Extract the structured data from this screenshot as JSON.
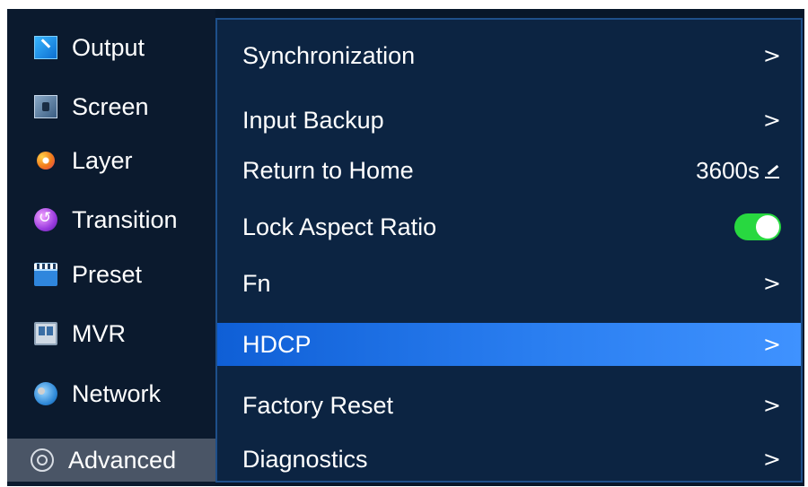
{
  "sidebar": {
    "items": [
      {
        "label": "Output",
        "icon": "output-icon"
      },
      {
        "label": "Screen",
        "icon": "screen-icon"
      },
      {
        "label": "Layer",
        "icon": "layer-icon"
      },
      {
        "label": "Transition",
        "icon": "transition-icon"
      },
      {
        "label": "Preset",
        "icon": "preset-icon"
      },
      {
        "label": "MVR",
        "icon": "mvr-icon"
      },
      {
        "label": "Network",
        "icon": "network-icon"
      },
      {
        "label": "Advanced",
        "icon": "advanced-icon",
        "active": true
      }
    ]
  },
  "menu": {
    "rows": [
      {
        "label": "Synchronization",
        "type": "submenu"
      },
      {
        "label": "Input Backup",
        "type": "submenu"
      },
      {
        "label": "Return to Home",
        "type": "value",
        "value": "3600s"
      },
      {
        "label": "Lock Aspect Ratio",
        "type": "toggle",
        "on": true
      },
      {
        "label": "Fn",
        "type": "submenu"
      },
      {
        "label": "HDCP",
        "type": "submenu",
        "selected": true
      },
      {
        "label": "Factory Reset",
        "type": "submenu"
      },
      {
        "label": "Diagnostics",
        "type": "submenu"
      }
    ],
    "chevron": ">"
  },
  "colors": {
    "background": "#08172a",
    "sidebar": "#0b1a2e",
    "panel": "#0c2442",
    "selection": "#2a7ef0",
    "toggle_on": "#28d840",
    "active_sidebar": "#4a5566"
  }
}
